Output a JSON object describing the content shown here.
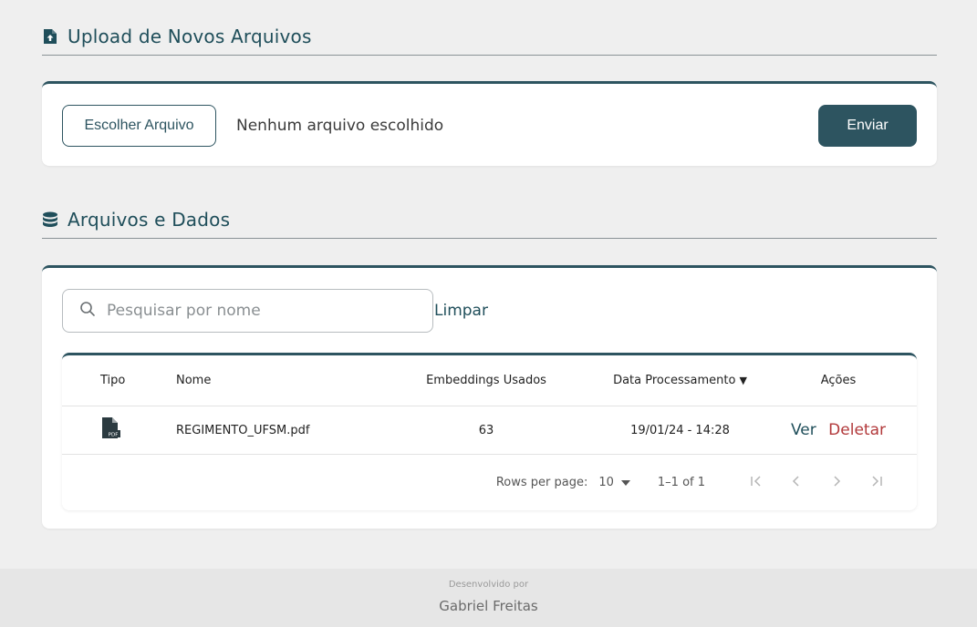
{
  "upload_section": {
    "title": "Upload de Novos Arquivos",
    "icon": "file-upload-icon",
    "choose_label": "Escolher Arquivo",
    "file_status": "Nenhum arquivo escolhido",
    "send_label": "Enviar"
  },
  "data_section": {
    "title": "Arquivos e Dados",
    "icon": "database-icon",
    "search_placeholder": "Pesquisar por nome",
    "clear_label": "Limpar",
    "columns": [
      "Tipo",
      "Nome",
      "Embeddings Usados",
      "Data Processamento",
      "Ações"
    ],
    "sort_indicator": "▼",
    "rows": [
      {
        "type_icon": "pdf-file-icon",
        "name": "REGIMENTO_UFSM.pdf",
        "embeddings": "63",
        "date": "19/01/24 - 14:28",
        "action_view": "Ver",
        "action_delete": "Deletar"
      }
    ],
    "pagination": {
      "rows_per_page_label": "Rows per page:",
      "rows_per_page_value": "10",
      "range": "1–1 of 1"
    }
  },
  "footer": {
    "developed_by": "Desenvolvido por",
    "author": "Gabriel Freitas"
  },
  "colors": {
    "primary": "#2d5460",
    "danger": "#b2393b",
    "background": "#efefef"
  }
}
